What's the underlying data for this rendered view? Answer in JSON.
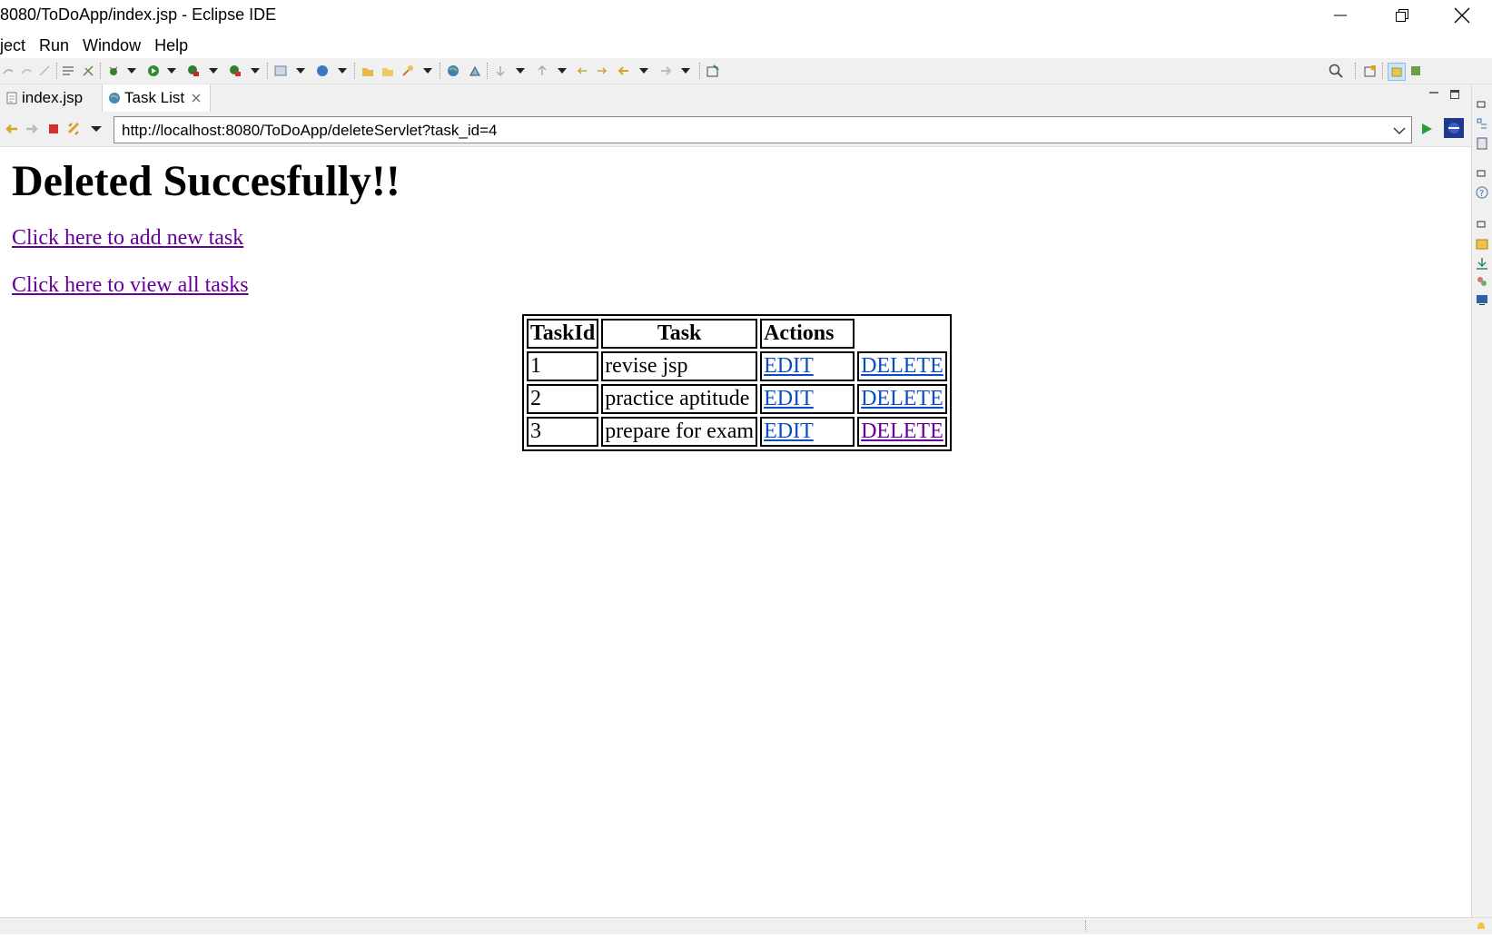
{
  "window": {
    "title": "8080/ToDoApp/index.jsp - Eclipse IDE"
  },
  "menu": [
    "ject",
    "Run",
    "Window",
    "Help"
  ],
  "tabs": [
    {
      "label": "index.jsp",
      "active": false
    },
    {
      "label": "Task List",
      "active": true
    }
  ],
  "browser": {
    "url": "http://localhost:8080/ToDoApp/deleteServlet?task_id=4"
  },
  "content": {
    "heading": "Deleted Succesfully!!",
    "link_add": "Click here to add new task",
    "link_view": "Click here to view all tasks",
    "table": {
      "headers": [
        "TaskId",
        "Task",
        "Actions"
      ],
      "rows": [
        {
          "id": "1",
          "task": "revise jsp",
          "edit": "EDIT",
          "delete": "DELETE"
        },
        {
          "id": "2",
          "task": "practice aptitude",
          "edit": "EDIT",
          "delete": "DELETE"
        },
        {
          "id": "3",
          "task": "prepare for exam",
          "edit": "EDIT",
          "delete": "DELETE"
        }
      ]
    }
  },
  "colors": {
    "link_unvisited": "#0b4dc5",
    "link_visited": "#660099",
    "chrome_bg": "#f0f0f0"
  }
}
